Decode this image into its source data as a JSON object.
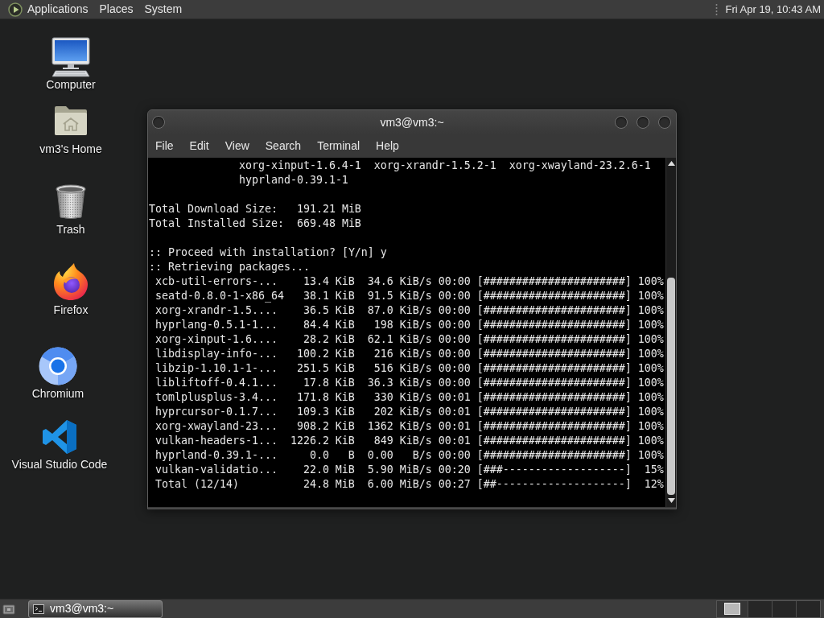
{
  "top_panel": {
    "menus": [
      {
        "kind": "launcher",
        "label": "Applications"
      },
      {
        "kind": "menu",
        "label": "Places"
      },
      {
        "kind": "menu",
        "label": "System"
      }
    ],
    "clock": "Fri Apr 19, 10:43 AM"
  },
  "desktop_icons": [
    {
      "kind": "computer",
      "label": "Computer"
    },
    {
      "kind": "home",
      "label": "vm3's Home"
    },
    {
      "kind": "trash",
      "label": "Trash"
    },
    {
      "kind": "firefox",
      "label": "Firefox"
    },
    {
      "kind": "chromium",
      "label": "Chromium"
    },
    {
      "kind": "vscode",
      "label": "Visual Studio Code"
    }
  ],
  "terminal_window": {
    "title": "vm3@vm3:~",
    "menu": [
      "File",
      "Edit",
      "View",
      "Search",
      "Terminal",
      "Help"
    ],
    "lines": [
      {
        "kind": "indented",
        "text": "xorg-xinput-1.6.4-1  xorg-xrandr-1.5.2-1  xorg-xwayland-23.2.6-1"
      },
      {
        "kind": "indented",
        "text": "hyprland-0.39.1-1"
      },
      {
        "kind": "blank"
      },
      {
        "kind": "plain",
        "text": "Total Download Size:   191.21 MiB"
      },
      {
        "kind": "plain",
        "text": "Total Installed Size:  669.48 MiB"
      },
      {
        "kind": "blank"
      },
      {
        "kind": "plain",
        "text": ":: Proceed with installation? [Y/n] y"
      },
      {
        "kind": "plain",
        "text": ":: Retrieving packages..."
      },
      {
        "kind": "progress",
        "text": "xcb-util-errors-...    13.4 KiB  34.6 KiB/s 00:00 [######################] 100%"
      },
      {
        "kind": "progress",
        "text": "seatd-0.8.0-1-x86_64   38.1 KiB  91.5 KiB/s 00:00 [######################] 100%"
      },
      {
        "kind": "progress",
        "text": "xorg-xrandr-1.5....    36.5 KiB  87.0 KiB/s 00:00 [######################] 100%"
      },
      {
        "kind": "progress",
        "text": "hyprlang-0.5.1-1...    84.4 KiB   198 KiB/s 00:00 [######################] 100%"
      },
      {
        "kind": "progress",
        "text": "xorg-xinput-1.6....    28.2 KiB  62.1 KiB/s 00:00 [######################] 100%"
      },
      {
        "kind": "progress",
        "text": "libdisplay-info-...   100.2 KiB   216 KiB/s 00:00 [######################] 100%"
      },
      {
        "kind": "progress",
        "text": "libzip-1.10.1-1-...   251.5 KiB   516 KiB/s 00:00 [######################] 100%"
      },
      {
        "kind": "progress",
        "text": "libliftoff-0.4.1...    17.8 KiB  36.3 KiB/s 00:00 [######################] 100%"
      },
      {
        "kind": "progress",
        "text": "tomlplusplus-3.4...   171.8 KiB   330 KiB/s 00:01 [######################] 100%"
      },
      {
        "kind": "progress",
        "text": "hyprcursor-0.1.7...   109.3 KiB   202 KiB/s 00:01 [######################] 100%"
      },
      {
        "kind": "progress",
        "text": "xorg-xwayland-23...   908.2 KiB  1362 KiB/s 00:01 [######################] 100%"
      },
      {
        "kind": "progress",
        "text": "vulkan-headers-1...  1226.2 KiB   849 KiB/s 00:01 [######################] 100%"
      },
      {
        "kind": "progress",
        "text": "hyprland-0.39.1-...     0.0   B  0.00   B/s 00:00 [######################] 100%"
      },
      {
        "kind": "progress",
        "text": "vulkan-validatio...    22.0 MiB  5.90 MiB/s 00:20 [###-------------------]  15%"
      },
      {
        "kind": "progress",
        "text": "Total (12/14)          24.8 MiB  6.00 MiB/s 00:27 [##--------------------]  12%"
      }
    ]
  },
  "bottom_panel": {
    "tasks": [
      {
        "label": "vm3@vm3:~"
      }
    ]
  }
}
